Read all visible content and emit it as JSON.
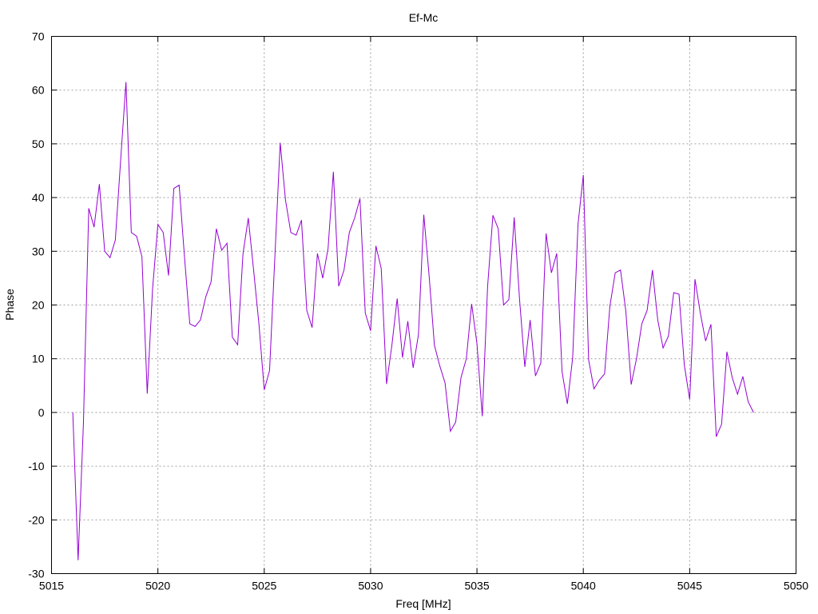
{
  "chart_data": {
    "type": "line",
    "title": "Ef-Mc",
    "xlabel": "Freq [MHz]",
    "ylabel": "Phase",
    "xlim": [
      5015,
      5050
    ],
    "ylim": [
      -30,
      70
    ],
    "xticks": [
      5015,
      5020,
      5025,
      5030,
      5035,
      5040,
      5045,
      5050
    ],
    "yticks": [
      -30,
      -20,
      -10,
      0,
      10,
      20,
      30,
      40,
      50,
      60,
      70
    ],
    "grid": true,
    "legend": "none",
    "series": [
      {
        "color": "#9400d3",
        "x": [
          5016.0,
          5016.25,
          5016.5,
          5016.75,
          5017.0,
          5017.25,
          5017.5,
          5017.75,
          5018.0,
          5018.25,
          5018.5,
          5018.75,
          5019.0,
          5019.25,
          5019.5,
          5019.75,
          5020.0,
          5020.25,
          5020.5,
          5020.75,
          5021.0,
          5021.25,
          5021.5,
          5021.75,
          5022.0,
          5022.25,
          5022.5,
          5022.75,
          5023.0,
          5023.25,
          5023.5,
          5023.75,
          5024.0,
          5024.25,
          5024.5,
          5024.75,
          5025.0,
          5025.25,
          5025.5,
          5025.75,
          5026.0,
          5026.25,
          5026.5,
          5026.75,
          5027.0,
          5027.25,
          5027.5,
          5027.75,
          5028.0,
          5028.25,
          5028.5,
          5028.75,
          5029.0,
          5029.25,
          5029.5,
          5029.75,
          5030.0,
          5030.25,
          5030.5,
          5030.75,
          5031.0,
          5031.25,
          5031.5,
          5031.75,
          5032.0,
          5032.25,
          5032.5,
          5032.75,
          5033.0,
          5033.25,
          5033.5,
          5033.75,
          5034.0,
          5034.25,
          5034.5,
          5034.75,
          5035.0,
          5035.25,
          5035.5,
          5035.75,
          5036.0,
          5036.25,
          5036.5,
          5036.75,
          5037.0,
          5037.25,
          5037.5,
          5037.75,
          5038.0,
          5038.25,
          5038.5,
          5038.75,
          5039.0,
          5039.25,
          5039.5,
          5039.75,
          5040.0,
          5040.25,
          5040.5,
          5040.75,
          5041.0,
          5041.25,
          5041.5,
          5041.75,
          5042.0,
          5042.25,
          5042.5,
          5042.75,
          5043.0,
          5043.25,
          5043.5,
          5043.75,
          5044.0,
          5044.25,
          5044.5,
          5044.75,
          5045.0,
          5045.25,
          5045.5,
          5045.75,
          5046.0,
          5046.25,
          5046.5,
          5046.75,
          5047.0,
          5047.25,
          5047.5,
          5047.75,
          5048.0
        ],
        "y": [
          0,
          -27.5,
          -2,
          38,
          34.5,
          42.5,
          30,
          28.8,
          32.1,
          47,
          61.5,
          33.5,
          32.8,
          29,
          3.5,
          23,
          35,
          33.5,
          25.5,
          41.7,
          42.3,
          29,
          16.5,
          16,
          17.2,
          21.5,
          24.3,
          34.2,
          30.2,
          31.5,
          14,
          12.6,
          29.5,
          36.2,
          26.5,
          16.5,
          4.2,
          7.8,
          29,
          50.2,
          39.5,
          33.5,
          33,
          35.8,
          19,
          15.8,
          29.6,
          25,
          30.5,
          44.8,
          23.5,
          26.5,
          33.5,
          36.2,
          39.8,
          18.5,
          15.2,
          31,
          26.8,
          5.3,
          12.5,
          21.2,
          10.2,
          17,
          8.3,
          14.5,
          36.8,
          25.5,
          12.5,
          8.7,
          5.5,
          -3.5,
          -1.8,
          6.5,
          10,
          20.2,
          12.8,
          -0.7,
          23.4,
          36.7,
          34.2,
          20,
          21,
          36.3,
          21.2,
          8.5,
          17.2,
          6.8,
          9.2,
          33.3,
          26,
          29.6,
          7.6,
          1.6,
          10.2,
          35,
          44.2,
          9.8,
          4.4,
          6,
          7.2,
          19.8,
          26,
          26.5,
          18.8,
          5.2,
          10,
          16.5,
          19,
          26.5,
          17.2,
          12,
          14.2,
          22.3,
          22,
          8.8,
          2.4,
          24.8,
          18.5,
          13.3,
          16.4,
          -4.5,
          -2.2,
          11.3,
          6.5,
          3.4,
          6.7,
          2,
          0
        ]
      }
    ]
  }
}
